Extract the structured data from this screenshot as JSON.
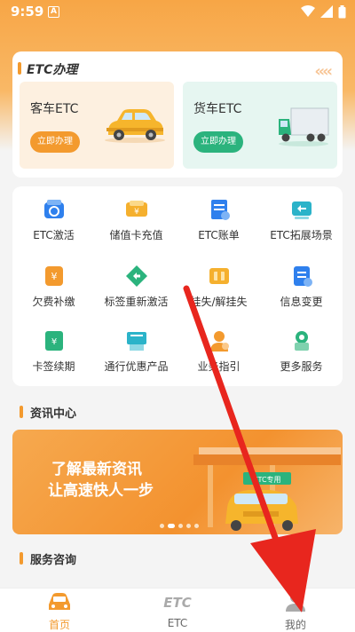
{
  "status": {
    "time": "9:59",
    "notif": "A"
  },
  "etc_section": {
    "title": "ETC办理",
    "car": {
      "label": "客车ETC",
      "button": "立即办理"
    },
    "truck": {
      "label": "货车ETC",
      "button": "立即办理"
    }
  },
  "services": [
    {
      "label": "ETC激活",
      "icon": "etc-activate-icon",
      "color": "#2f80ed"
    },
    {
      "label": "储值卡充值",
      "icon": "stored-card-recharge-icon",
      "color": "#f5b02e"
    },
    {
      "label": "ETC账单",
      "icon": "etc-bill-icon",
      "color": "#2f80ed"
    },
    {
      "label": "ETC拓展场景",
      "icon": "etc-scene-icon",
      "color": "#2bb3c9"
    },
    {
      "label": "欠费补缴",
      "icon": "arrears-payment-icon",
      "color": "#f39a2e"
    },
    {
      "label": "标签重新激活",
      "icon": "tag-reactivate-icon",
      "color": "#2bb37d"
    },
    {
      "label": "挂失/解挂失",
      "icon": "report-loss-icon",
      "color": "#f5b02e"
    },
    {
      "label": "信息变更",
      "icon": "info-change-icon",
      "color": "#2f80ed"
    },
    {
      "label": "卡签续期",
      "icon": "card-renew-icon",
      "color": "#2bb37d"
    },
    {
      "label": "通行优惠产品",
      "icon": "toll-discount-icon",
      "color": "#2bb3c9"
    },
    {
      "label": "业务指引",
      "icon": "business-guide-icon",
      "color": "#f39a2e"
    },
    {
      "label": "更多服务",
      "icon": "more-services-icon",
      "color": "#2bb37d"
    }
  ],
  "news": {
    "title": "资讯中心",
    "banner_line1": "了解最新资讯",
    "banner_line2": "让高速快人一步",
    "sign": "ETC专用",
    "slide_count": 5,
    "active_slide": 1
  },
  "consult": {
    "title": "服务咨询"
  },
  "nav": {
    "home": "首页",
    "etc": "ETC",
    "mine": "我的",
    "active": "home",
    "accent": "#f39a2e"
  }
}
